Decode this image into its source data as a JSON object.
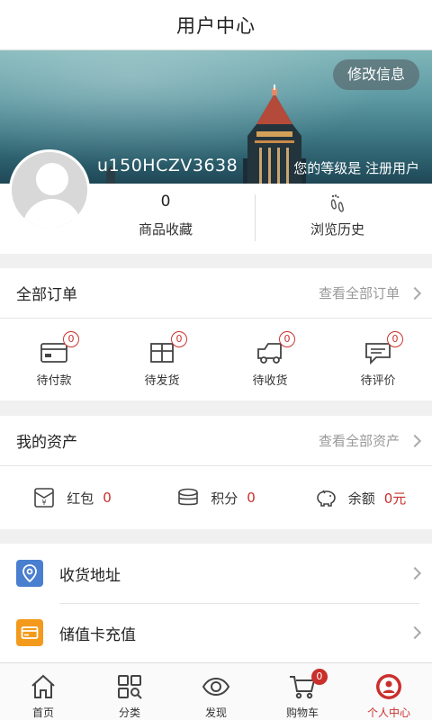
{
  "header": {
    "title": "用户中心"
  },
  "profile": {
    "edit_label": "修改信息",
    "username": "u150HCZV3638",
    "level_text": "您的等级是 注册用户",
    "favorites_count": "0",
    "favorites_label": "商品收藏",
    "history_label": "浏览历史"
  },
  "orders": {
    "title": "全部订单",
    "view_all": "查看全部订单",
    "items": [
      {
        "label": "待付款",
        "count": "0",
        "icon": "wallet-card-icon"
      },
      {
        "label": "待发货",
        "count": "0",
        "icon": "box-icon"
      },
      {
        "label": "待收货",
        "count": "0",
        "icon": "truck-icon"
      },
      {
        "label": "待评价",
        "count": "0",
        "icon": "comment-icon"
      }
    ]
  },
  "assets": {
    "title": "我的资产",
    "view_all": "查看全部资产",
    "items": [
      {
        "label": "红包",
        "value": "0",
        "icon": "red-envelope-icon"
      },
      {
        "label": "积分",
        "value": "0",
        "icon": "coins-icon"
      },
      {
        "label": "余额",
        "value": "0元",
        "icon": "piggy-bank-icon"
      }
    ]
  },
  "menu": {
    "items": [
      {
        "label": "收货地址",
        "icon": "location-pin-icon",
        "color": "#4a7fd0"
      },
      {
        "label": "储值卡充值",
        "icon": "card-icon",
        "color": "#f39a1c"
      }
    ]
  },
  "tabbar": {
    "items": [
      {
        "label": "首页",
        "icon": "home-icon"
      },
      {
        "label": "分类",
        "icon": "category-grid-icon"
      },
      {
        "label": "发现",
        "icon": "eye-icon"
      },
      {
        "label": "购物车",
        "icon": "cart-icon",
        "badge": "0"
      },
      {
        "label": "个人中心",
        "icon": "user-circle-icon",
        "active": true
      }
    ]
  },
  "colors": {
    "accent": "#c9302c",
    "muted": "#999999"
  }
}
